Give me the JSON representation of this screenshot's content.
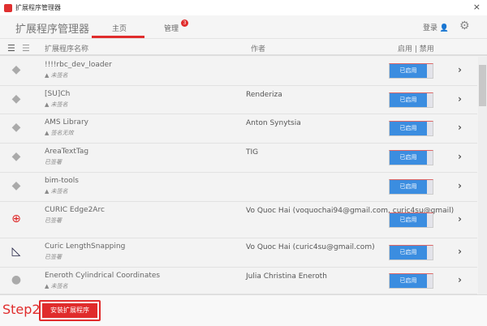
{
  "window": {
    "title": "扩展程序管理器",
    "close": "×"
  },
  "nav": {
    "app_title": "扩展程序管理器",
    "tab_home": "主页",
    "tab_manage": "管理",
    "manage_badge": "3",
    "login": "登录 👤",
    "settings_icon": "⚙"
  },
  "columns": {
    "name": "扩展程序名称",
    "author": "作者",
    "toggle": "启用 | 禁用"
  },
  "extensions": [
    {
      "name": "!!!!rbc_dev_loader",
      "signature": "▲ 未签名",
      "author": "",
      "status": "已启用",
      "icon": "gem-icon"
    },
    {
      "name": "[SU]Ch",
      "signature": "▲ 未签名",
      "author": "Renderiza",
      "status": "已启用",
      "icon": "gem-icon"
    },
    {
      "name": "AMS Library",
      "signature": "▲ 签名无效",
      "author": "Anton Synytsia",
      "status": "已启用",
      "icon": "gem-icon"
    },
    {
      "name": "AreaTextTag",
      "signature": "已签署",
      "author": "TIG",
      "status": "已启用",
      "icon": "gem-icon"
    },
    {
      "name": "bim-tools",
      "signature": "▲ 未签名",
      "author": "",
      "status": "已启用",
      "icon": "gem-icon"
    },
    {
      "name": "CURIC Edge2Arc",
      "signature": "已签署",
      "author": "Vo Quoc Hai (voquochai94@gmail.com, curic4su@gmail)",
      "status": "已启用",
      "icon": "arc-icon"
    },
    {
      "name": "Curic LengthSnapping",
      "signature": "已签署",
      "author": "Vo Quoc Hai (curic4su@gmail.com)",
      "status": "已启用",
      "icon": "snap-icon"
    },
    {
      "name": "Eneroth Cylindrical Coordinates",
      "signature": "▲ 未签名",
      "author": "Julia Christina Eneroth",
      "status": "已启用",
      "icon": "cylinder-icon"
    }
  ],
  "footer": {
    "step": "Step2",
    "install": "安装扩展程序"
  }
}
